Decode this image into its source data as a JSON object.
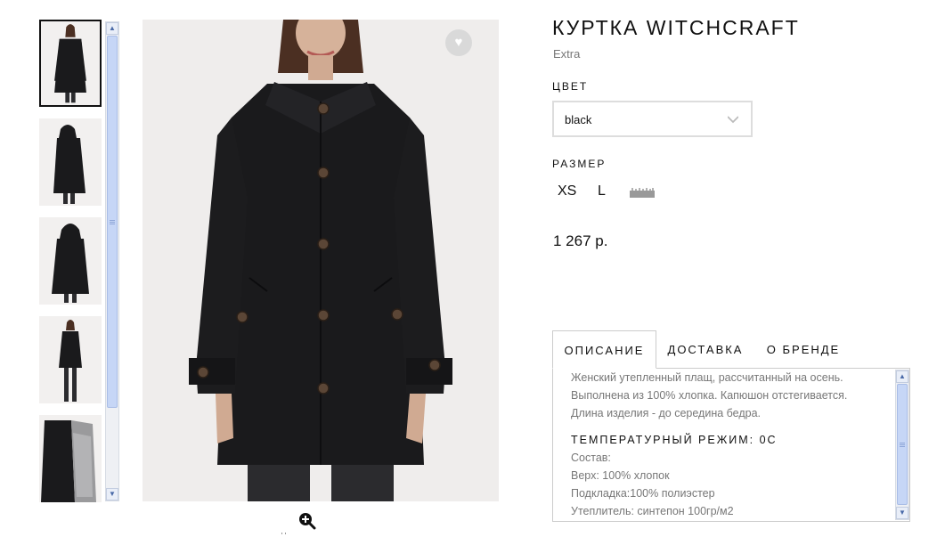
{
  "product": {
    "title": "КУРТКА WITCHCRAFT",
    "brand": "Extra",
    "color_label": "ЦВЕТ",
    "color_value": "black",
    "size_label": "РАЗМЕР",
    "sizes": [
      "XS",
      "L"
    ],
    "price": "1 267 р."
  },
  "gallery": {
    "thumbnail_count": 5,
    "active_index": 0
  },
  "tabs": [
    {
      "label": "ОПИСАНИЕ",
      "active": true
    },
    {
      "label": "ДОСТАВКА",
      "active": false
    },
    {
      "label": "О БРЕНДЕ",
      "active": false
    }
  ],
  "description": {
    "lines": [
      "Женский утепленный плащ, рассчитанный на осень.",
      "Выполнена из 100% хлопка. Капюшон отстегивается.",
      "Длина изделия - до середина бедра."
    ],
    "temperature_heading": "ТЕМПЕРАТУРНЫЙ РЕЖИМ: 0С",
    "composition": [
      "Состав:",
      "Верх: 100% хлопок",
      "Подкладка:100% полиэстер",
      "Утеплитель: синтепон 100гр/м2"
    ]
  },
  "icons": {
    "favorite": "heart-icon",
    "zoom": "zoom-in-icon",
    "size_chart": "ruler-icon",
    "dropdown": "chevron-down-icon"
  },
  "colors": {
    "garment": "#1a1a1c",
    "photo_bg": "#efedec",
    "scrollbar": "#c6d6f6",
    "tab_border": "#cccccc"
  }
}
